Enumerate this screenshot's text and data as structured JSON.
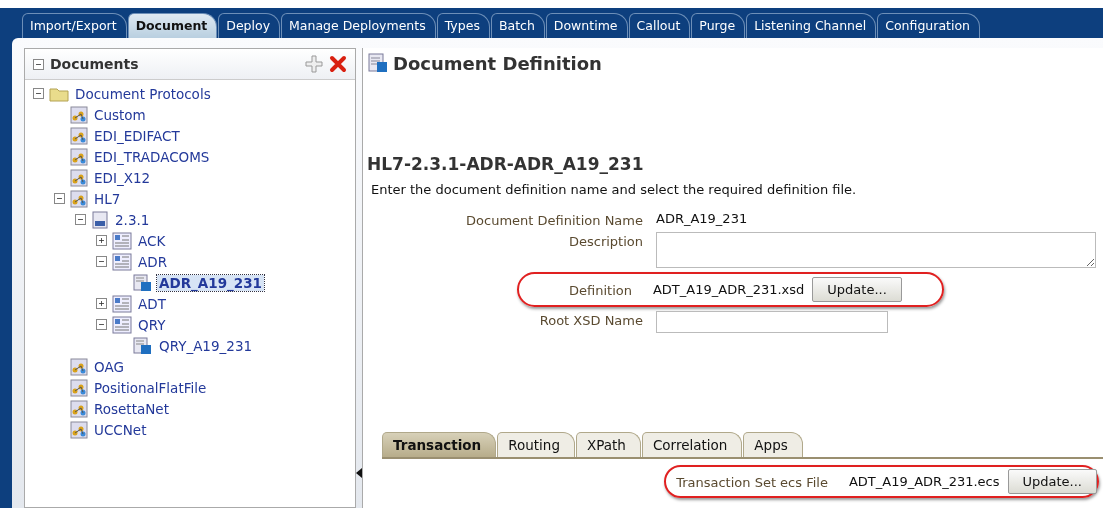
{
  "main_tabs": [
    {
      "label": "Import/Export",
      "selected": false
    },
    {
      "label": "Document",
      "selected": true
    },
    {
      "label": "Deploy",
      "selected": false
    },
    {
      "label": "Manage Deployments",
      "selected": false
    },
    {
      "label": "Types",
      "selected": false
    },
    {
      "label": "Batch",
      "selected": false
    },
    {
      "label": "Downtime",
      "selected": false
    },
    {
      "label": "Callout",
      "selected": false
    },
    {
      "label": "Purge",
      "selected": false
    },
    {
      "label": "Listening Channel",
      "selected": false
    },
    {
      "label": "Configuration",
      "selected": false
    }
  ],
  "documents_panel": {
    "title": "Documents",
    "expanded": true,
    "tree": [
      {
        "label": "Document Protocols",
        "kind": "folder",
        "expanded": true,
        "selected": false,
        "children": [
          {
            "label": "Custom",
            "kind": "protocol",
            "selected": false
          },
          {
            "label": "EDI_EDIFACT",
            "kind": "protocol",
            "selected": false
          },
          {
            "label": "EDI_TRADACOMS",
            "kind": "protocol",
            "selected": false
          },
          {
            "label": "EDI_X12",
            "kind": "protocol",
            "selected": false
          },
          {
            "label": "HL7",
            "kind": "protocol",
            "expanded": true,
            "selected": false,
            "children": [
              {
                "label": "2.3.1",
                "kind": "version",
                "expanded": true,
                "selected": false,
                "children": [
                  {
                    "label": "ACK",
                    "kind": "doctype",
                    "expanded": false,
                    "selected": false
                  },
                  {
                    "label": "ADR",
                    "kind": "doctype",
                    "expanded": true,
                    "selected": false,
                    "children": [
                      {
                        "label": "ADR_A19_231",
                        "kind": "definition",
                        "selected": true
                      }
                    ]
                  },
                  {
                    "label": "ADT",
                    "kind": "doctype",
                    "expanded": false,
                    "selected": false
                  },
                  {
                    "label": "QRY",
                    "kind": "doctype",
                    "expanded": true,
                    "selected": false,
                    "children": [
                      {
                        "label": "QRY_A19_231",
                        "kind": "definition",
                        "selected": false
                      }
                    ]
                  }
                ]
              }
            ]
          },
          {
            "label": "OAG",
            "kind": "protocol",
            "selected": false
          },
          {
            "label": "PositionalFlatFile",
            "kind": "protocol",
            "selected": false
          },
          {
            "label": "RosettaNet",
            "kind": "protocol",
            "selected": false
          },
          {
            "label": "UCCNet",
            "kind": "protocol",
            "selected": false
          }
        ]
      }
    ]
  },
  "definition_panel": {
    "title": "Document Definition",
    "heading": "HL7-2.3.1-ADR-ADR_A19_231",
    "instructions": "Enter the document definition name and select the required definition file.",
    "fields": [
      {
        "label": "Document Definition Name",
        "kind": "text",
        "value": "ADR_A19_231"
      },
      {
        "label": "Description",
        "kind": "textarea"
      },
      {
        "label": "Definition",
        "kind": "file",
        "value": "ADT_A19_ADR_231.xsd",
        "button": "Update...",
        "highlighted": true
      },
      {
        "label": "Root XSD Name",
        "kind": "input"
      }
    ]
  },
  "detail_tabs": [
    {
      "label": "Transaction",
      "selected": true
    },
    {
      "label": "Routing",
      "selected": false
    },
    {
      "label": "XPath",
      "selected": false
    },
    {
      "label": "Correlation",
      "selected": false
    },
    {
      "label": "Apps",
      "selected": false
    }
  ],
  "transaction_fields": [
    {
      "label": "Transaction Set ecs File",
      "kind": "file",
      "value": "ADT_A19_ADR_231.ecs",
      "button": "Update...",
      "highlighted": true
    }
  ]
}
